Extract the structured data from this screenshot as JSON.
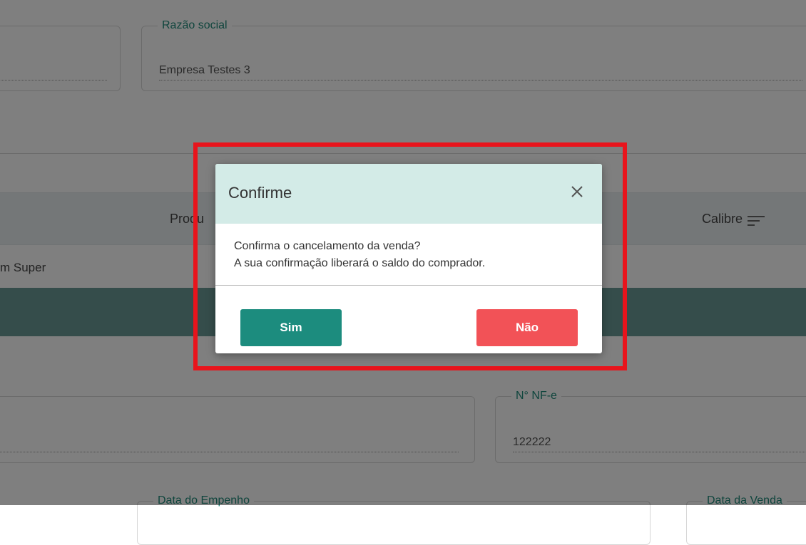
{
  "background": {
    "razao_social": {
      "label": "Razão social",
      "value": "Empresa Testes 3"
    },
    "table": {
      "headers": {
        "produto": "Produ",
        "calibre": "Calibre"
      },
      "row_text": "m Super"
    },
    "nfe": {
      "label": "N° NF-e",
      "value": "122222"
    },
    "data_empenho": {
      "label": "Data do Empenho"
    },
    "data_venda": {
      "label": "Data da Venda"
    }
  },
  "modal": {
    "title": "Confirme",
    "message_line1": "Confirma o cancelamento da venda?",
    "message_line2": "A sua confirmação liberará o saldo do comprador.",
    "yes_label": "Sim",
    "no_label": "Não"
  },
  "colors": {
    "accent": "#1c8c7e",
    "danger": "#f25257",
    "header_bg": "#d3ebe7",
    "highlight": "#e8141c"
  },
  "icons": {
    "close": "close-icon",
    "filter": "filter-icon"
  }
}
